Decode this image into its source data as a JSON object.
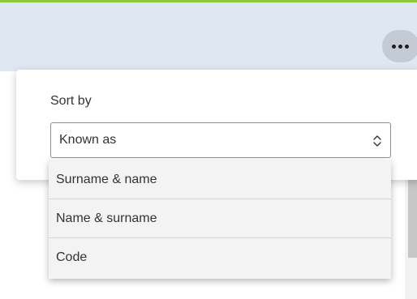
{
  "header": {
    "accent_color": "#8cc63f",
    "background_color": "#dfe8f1",
    "more_button_icon": "more-horizontal-icon"
  },
  "sort_panel": {
    "label": "Sort by",
    "select": {
      "value": "Known as",
      "icon": "up-down-chevrons-icon"
    },
    "options": [
      "Surname & name",
      "Name & surname",
      "Code"
    ]
  }
}
